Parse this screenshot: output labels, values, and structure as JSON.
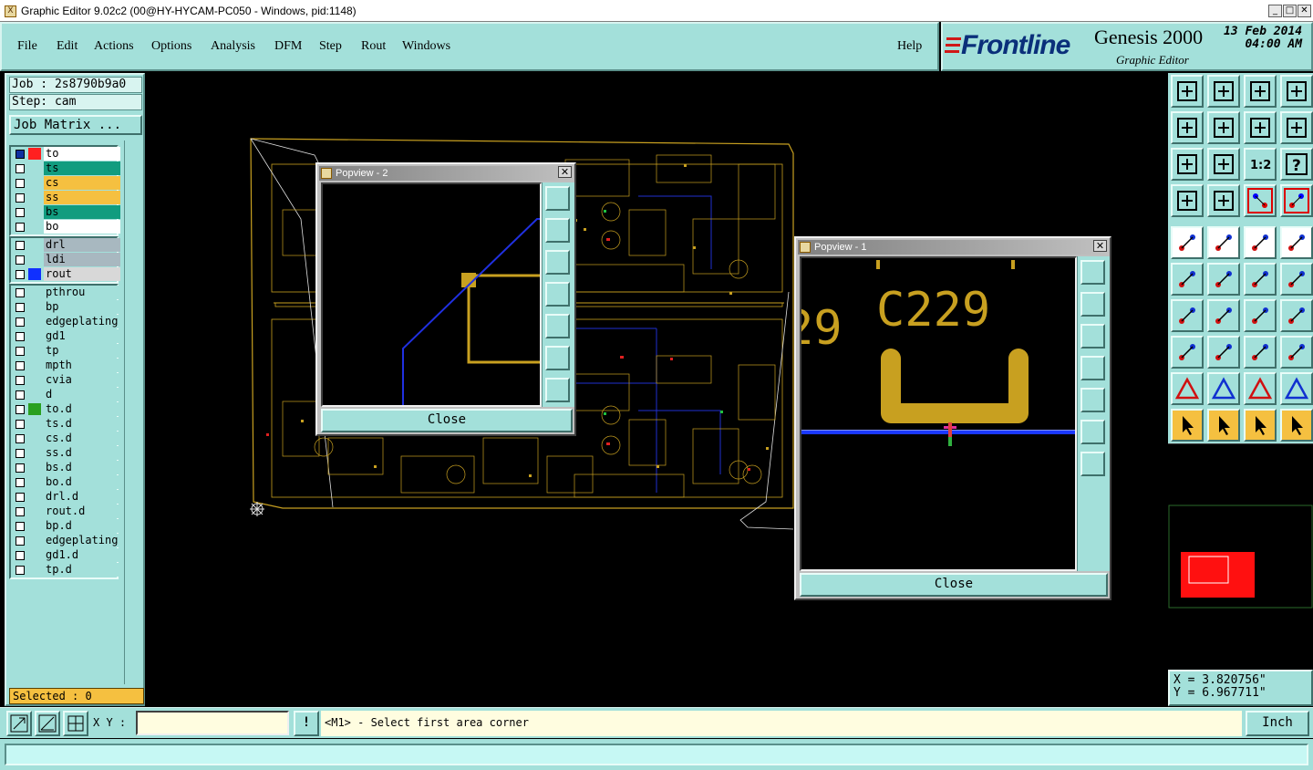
{
  "window": {
    "title": "Graphic Editor 9.02c2 (00@HY-HYCAM-PC050 - Windows, pid:1148)",
    "icon_glyph": "X",
    "minimize_glyph": "_",
    "maximize_glyph": "□",
    "close_glyph": "✕"
  },
  "menu": [
    "File",
    "Edit",
    "Actions",
    "Options",
    "Analysis",
    "DFM",
    "Step",
    "Rout",
    "Windows"
  ],
  "help_label": "Help",
  "branding": {
    "logo": "Frontline",
    "product": "Genesis 2000",
    "subtitle": "Graphic Editor",
    "date": "13 Feb 2014",
    "time": "04:00 AM",
    "logo_color": "#0a2f7a",
    "logo_accent": "#d01818"
  },
  "job": {
    "job_label": "Job : 2s8790b9a0",
    "step_label": "Step: cam",
    "matrix_button": "Job Matrix ..."
  },
  "layer_groups": [
    [
      {
        "name": "to",
        "bg": "#ffffff",
        "swatch": "#ff2020",
        "active": true,
        "mark": "▪"
      },
      {
        "name": "ts",
        "bg": "#119c7f",
        "swatch": ""
      },
      {
        "name": "cs",
        "bg": "#f5c040",
        "swatch": ""
      },
      {
        "name": "ss",
        "bg": "#f5c040",
        "swatch": ""
      },
      {
        "name": "bs",
        "bg": "#119c7f",
        "swatch": ""
      },
      {
        "name": "bo",
        "bg": "#ffffff",
        "swatch": ""
      }
    ],
    [
      {
        "name": "drl",
        "bg": "#a8b8c0",
        "swatch": ""
      },
      {
        "name": "ldi",
        "bg": "#a8b8c0",
        "swatch": ""
      },
      {
        "name": "rout",
        "bg": "#d8d8d8",
        "swatch": "#1030ff",
        "mark": "✐"
      }
    ],
    [
      {
        "name": "pthrou",
        "bg": "#a3e0da",
        "swatch": ""
      },
      {
        "name": "bp",
        "bg": "#a3e0da",
        "swatch": ""
      },
      {
        "name": "edgeplating",
        "bg": "#a3e0da",
        "swatch": ""
      },
      {
        "name": "gd1",
        "bg": "#a3e0da",
        "swatch": "",
        "mark": "✐"
      },
      {
        "name": "tp",
        "bg": "#a3e0da",
        "swatch": ""
      },
      {
        "name": "mpth",
        "bg": "#a3e0da",
        "swatch": ""
      },
      {
        "name": "cvia",
        "bg": "#a3e0da",
        "swatch": ""
      },
      {
        "name": "d",
        "bg": "#a3e0da",
        "swatch": ""
      },
      {
        "name": "to.d",
        "bg": "#a3e0da",
        "swatch": "#2aa020",
        "mark": "✐"
      },
      {
        "name": "ts.d",
        "bg": "#a3e0da",
        "swatch": ""
      },
      {
        "name": "cs.d",
        "bg": "#a3e0da",
        "swatch": ""
      },
      {
        "name": "ss.d",
        "bg": "#a3e0da",
        "swatch": ""
      },
      {
        "name": "bs.d",
        "bg": "#a3e0da",
        "swatch": ""
      },
      {
        "name": "bo.d",
        "bg": "#a3e0da",
        "swatch": ""
      },
      {
        "name": "drl.d",
        "bg": "#a3e0da",
        "swatch": ""
      },
      {
        "name": "rout.d",
        "bg": "#a3e0da",
        "swatch": "",
        "mark": "✐"
      },
      {
        "name": "bp.d",
        "bg": "#a3e0da",
        "swatch": ""
      },
      {
        "name": "edgeplating",
        "bg": "#a3e0da",
        "swatch": ""
      },
      {
        "name": "gd1.d",
        "bg": "#a3e0da",
        "swatch": "",
        "mark": "✐"
      },
      {
        "name": "tp.d",
        "bg": "#a3e0da",
        "swatch": ""
      }
    ]
  ],
  "selected_label": "Selected : 0",
  "popview2": {
    "title": "Popview - 2",
    "close_label": "Close",
    "close_glyph": "✕"
  },
  "popview1": {
    "title": "Popview - 1",
    "close_label": "Close",
    "close_glyph": "✕",
    "designator": "C229",
    "designator_partial": "29"
  },
  "toolbar_buttons": [
    [
      "zoom-home-icon",
      "zoom-in-icon",
      "home-icon",
      "window-icon"
    ],
    [
      "pan-left-icon",
      "pan-right-icon",
      "undo-zoom-icon",
      "redraw-icon"
    ],
    [
      "fit-all-icon",
      "zoom-center-icon",
      "scale-1-2-icon",
      "help-icon"
    ],
    [
      "tool-settings-icon",
      "grid-icon",
      "net-red-icon",
      "net-red-alt-icon"
    ],
    [
      "circle-pad-icon",
      "select-color-icon",
      "ruler-icon",
      "snap-circle-icon"
    ],
    [
      "connect-pads-icon",
      "cross-cut-icon",
      "add-line-icon",
      "add-arrow-icon"
    ],
    [
      "angle-icon",
      "diagonal-line-icon",
      "rotate-icon",
      "mirror-icon"
    ],
    [
      "pad-to-pad-icon",
      "line-break-icon",
      "measure-icon",
      "shape-icon"
    ],
    [
      "triangle-red-icon",
      "triangle-blue-icon",
      "triangle-up-icon",
      "triangle-move-icon"
    ],
    [
      "select-arrow-icon",
      "select-box-icon",
      "select-net-icon",
      "select-step-icon"
    ]
  ],
  "toolbar_labels": {
    "scale": "1:2",
    "help": "?"
  },
  "coords": {
    "x": "X = 3.820756\"",
    "y": "Y = 6.967711\""
  },
  "bottom": {
    "xy_label": "X Y :",
    "xy_value": "",
    "bang": "!",
    "message": "<M1> - Select first area corner",
    "unit": "Inch"
  }
}
